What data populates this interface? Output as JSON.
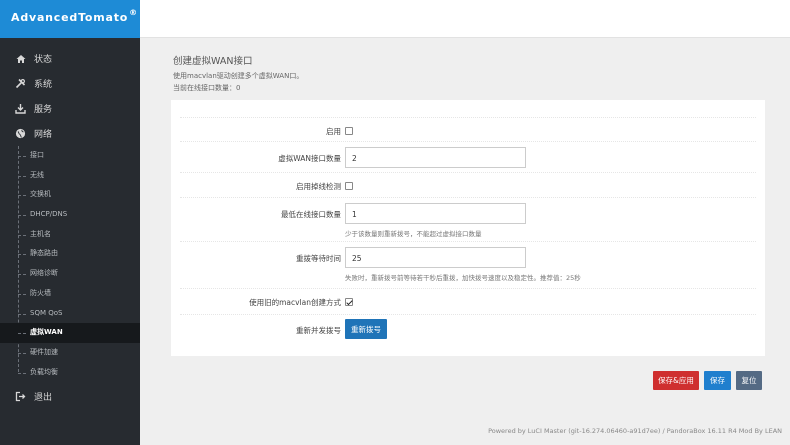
{
  "brand": {
    "name": "AdvancedTomato",
    "mark": "®"
  },
  "sidebar": {
    "items": [
      {
        "icon": "home-icon",
        "label": "状态"
      },
      {
        "icon": "tools-icon",
        "label": "系统"
      },
      {
        "icon": "download-icon",
        "label": "服务"
      },
      {
        "icon": "globe-icon",
        "label": "网络"
      }
    ],
    "network_sub": [
      "接口",
      "无线",
      "交换机",
      "DHCP/DNS",
      "主机名",
      "静态路由",
      "网络诊断",
      "防火墙",
      "SQM QoS",
      "虚拟WAN",
      "硬件加速",
      "负载均衡"
    ],
    "active_sub": "虚拟WAN",
    "logout": {
      "icon": "logout-icon",
      "label": "退出"
    }
  },
  "page": {
    "title": "创建虚拟WAN接口",
    "desc1": "使用macvlan驱动创建多个虚拟WAN口。",
    "desc2": "当前在线接口数量：0"
  },
  "form": {
    "enable": {
      "label": "启用",
      "checked": false
    },
    "count": {
      "label": "虚拟WAN接口数量",
      "value": "2"
    },
    "detect": {
      "label": "启用掉线检测",
      "checked": false
    },
    "min_online": {
      "label": "最低在线接口数量",
      "value": "1",
      "help": "少于该数量则重新拨号，不能超过虚拟接口数量"
    },
    "wait": {
      "label": "重拨等待时间",
      "value": "25",
      "help": "失败时，重新拨号前等待若干秒后重拨，加快拨号速度以及稳定性。推荐值：25秒"
    },
    "legacy": {
      "label": "使用旧的macvlan创建方式",
      "checked": true
    },
    "redial": {
      "label": "重新并发拨号",
      "button": "重新拨号"
    }
  },
  "actions": {
    "save_apply": "保存&应用",
    "save": "保存",
    "reset": "复位"
  },
  "footer": "Powered by LuCI Master (git-16.274.06460-a91d7ee) / PandoraBox 16.11 R4 Mod By LEAN",
  "colors": {
    "brand_bg": "#1e8bd6",
    "sidebar_bg": "#272b30",
    "primary": "#1f74b8",
    "danger": "#cf2f2f"
  }
}
